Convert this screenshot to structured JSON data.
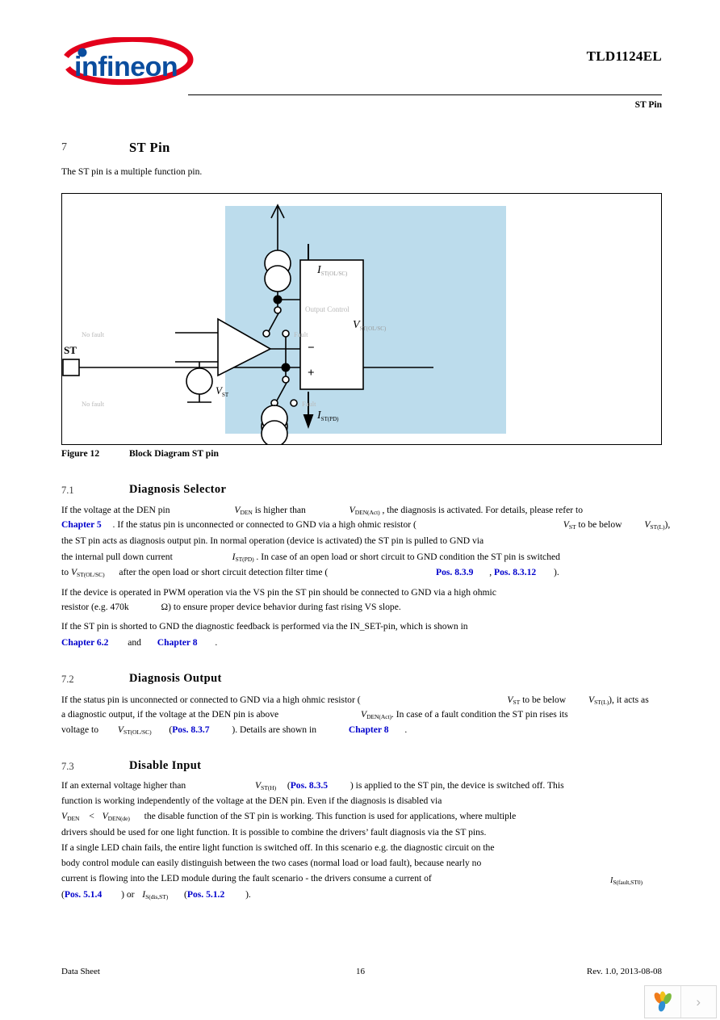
{
  "header": {
    "doc_title": "TLD1124EL",
    "section_tag": "ST Pin",
    "logo_name": "infineon"
  },
  "sections": {
    "s7": {
      "number": "7",
      "title": "ST  Pin"
    },
    "s7_intro": "The ST pin is a multiple function pin.",
    "s71": {
      "number": "7.1",
      "title": "Diagnosis Selector"
    },
    "s72": {
      "number": "7.2",
      "title": "Diagnosis Output"
    },
    "s73": {
      "number": "7.3",
      "title": "Disable Input"
    }
  },
  "figure": {
    "caption_label": "Figure 12",
    "caption_title": "Block Diagram ST pin",
    "blue_fill": "#bcdcec",
    "labels": {
      "st_pin": "ST",
      "no_fault_top": "No fault",
      "fault_top": "Fault",
      "no_fault_bottom": "No fault",
      "fault_bottom": "Fault",
      "current_top_var": "I",
      "current_top_sub": "ST(OL/SC)",
      "zener_var": "V",
      "zener_sub": "ST(OL/SC)",
      "current_bottom_var": "I",
      "current_bottom_sub": "ST(PD)",
      "vsource_var": "V",
      "vsource_sub": "ST",
      "output_control": "Output Control",
      "comparator_minus": "−",
      "comparator_plus": "+"
    }
  },
  "body": {
    "p71_l1_a": "If the voltage at the DEN pin",
    "p71_l1_v1": "V",
    "p71_l1_v1sub": "DEN",
    "p71_l1_b": "is higher than",
    "p71_l1_v2": "V",
    "p71_l1_v2sub": "DEN(Act)",
    "p71_l1_c": ", the diagnosis is activated. For details, please refer to",
    "p71_l2_link": "Chapter 5",
    "p71_l2_a": ". If the status pin is unconnected or connected to GND via a high ohmic resistor (",
    "p71_l2_v1": "V",
    "p71_l2_v1sub": "ST",
    "p71_l2_b": "to be below",
    "p71_l2_v2": "V",
    "p71_l2_v2sub": "ST(L)",
    "p71_l2_c": "),",
    "p71_l3": "the ST pin acts as diagnosis output pin. In normal operation (device is activated) the ST pin is pulled to GND via",
    "p71_l4_a": "the internal pull down current",
    "p71_l4_v": "I",
    "p71_l4_vsub": "ST(PD)",
    "p71_l4_b": ". In case of an open load or short circuit to GND condition the ST pin is switched",
    "p71_l5_a": "to",
    "p71_l5_v": "V",
    "p71_l5_vsub": "ST(OL/SC)",
    "p71_l5_b": "after the open load or short circuit detection filter time (",
    "p71_l5_link1": "Pos. 8.3.9",
    "p71_l5_c": ",",
    "p71_l5_link2": "Pos. 8.3.12",
    "p71_l5_d": ").",
    "p71_l6": "If the device is operated in PWM operation via the VS pin the ST pin should be connected to GND via a high ohmic",
    "p71_l7_a": "resistor (e.g. 470k",
    "p71_l7_ohm": "Ω",
    "p71_l7_b": ") to ensure proper device behavior during fast rising VS slope.",
    "p71_l8": "If the ST pin is shorted to GND the diagnostic feedback is performed via the IN_SET-pin, which is shown in",
    "p71_l9_link1": "Chapter 6.2",
    "p71_l9_and": "and",
    "p71_l9_link2": "Chapter 8",
    "p71_l9_dot": ".",
    "p72_l1_a": "If the status pin is unconnected or connected to GND via a high ohmic resistor (",
    "p72_l1_v1": "V",
    "p72_l1_v1sub": "ST",
    "p72_l1_b": "to be below",
    "p72_l1_v2": "V",
    "p72_l1_v2sub": "ST(L)",
    "p72_l1_c": "), it acts as",
    "p72_l2_a": "a diagnostic output, if the voltage at the DEN pin is above",
    "p72_l2_v": "V",
    "p72_l2_vsub": "DEN(Act)",
    "p72_l2_b": ". In case of a fault condition the ST pin rises its",
    "p72_l3_a": "voltage to",
    "p72_l3_v": "V",
    "p72_l3_vsub": "ST(OL/SC)",
    "p72_l3_b": "(",
    "p72_l3_link1": "Pos. 8.3.7",
    "p72_l3_c": "). Details are shown in",
    "p72_l3_link2": "Chapter 8",
    "p72_l3_d": ".",
    "p73_l1_a": "If an external voltage higher than",
    "p73_l1_v": "V",
    "p73_l1_vsub": "ST(H)",
    "p73_l1_b": "(",
    "p73_l1_link": "Pos. 8.3.5",
    "p73_l1_c": ") is applied to the ST pin, the device is switched off. This",
    "p73_l2": "function is working independently of the voltage at the DEN pin. Even if the diagnosis is disabled via",
    "p73_l3_v1": "V",
    "p73_l3_v1sub": "DEN",
    "p73_l3_lt": "<",
    "p73_l3_v2": "V",
    "p73_l3_v2sub": "DEN(de)",
    "p73_l3_a": "the disable function of the ST pin is working. This function is used for applications, where multiple",
    "p73_l4": "drivers should be used for one light function. It is possible to combine the drivers’ fault diagnosis via the ST pins.",
    "p73_l5": "If a single LED chain fails, the entire light function is switched off. In this scenario e.g. the diagnostic circuit on the",
    "p73_l6": "body control module can easily distinguish between the two cases (normal load or load fault), because nearly no",
    "p73_l7": "current is flowing into the LED module during the fault scenario - the drivers consume a current of",
    "p73_l7_v": "I",
    "p73_l7_vsub": "S(fault,ST0)",
    "p73_l8_link1": "Pos. 5.1.4",
    "p73_l8_a": ") or",
    "p73_l8_v": "I",
    "p73_l8_vsub": "S(dis,ST)",
    "p73_l8_b": "(",
    "p73_l8_link2": "Pos. 5.1.2",
    "p73_l8_c": ").",
    "p73_l8_open": "("
  },
  "footer": {
    "left": "Data Sheet",
    "page": "16",
    "right": "Rev. 1.0, 2013-08-08"
  },
  "viewer": {
    "logo_name": "leaf-logo",
    "next_glyph": "›"
  }
}
